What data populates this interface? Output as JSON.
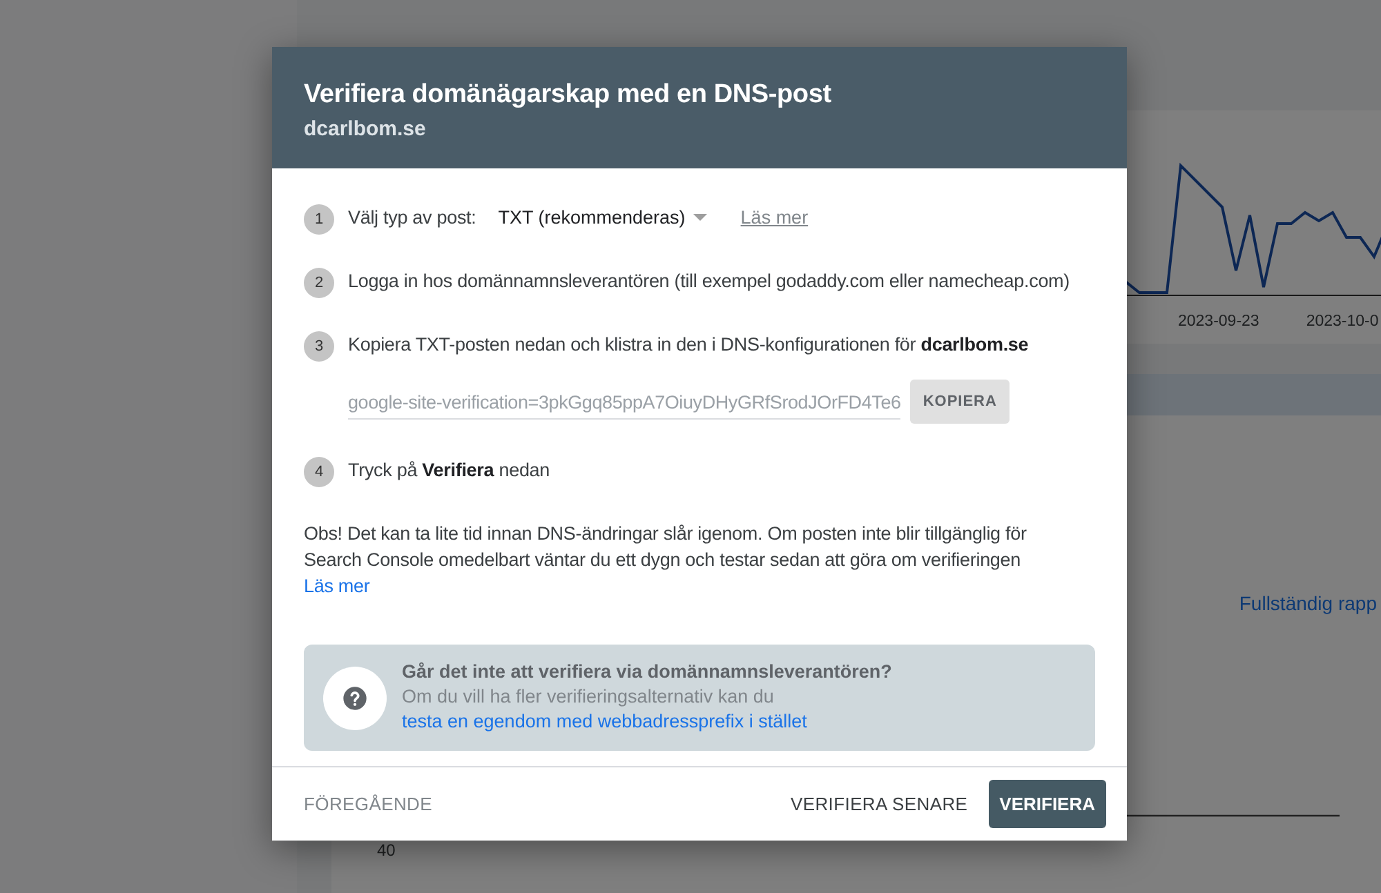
{
  "background": {
    "date_labels": [
      "2023-09-23",
      "2023-10-0"
    ],
    "report_link": "Fullständig rapp",
    "axis_label": "40"
  },
  "dialog": {
    "title": "Verifiera domänägarskap med en DNS-post",
    "subtitle": "dcarlbom.se",
    "steps": [
      {
        "number": "1",
        "kind": "select",
        "label": "Välj typ av post:",
        "value": "TXT (rekommenderas)",
        "link": "Läs mer"
      },
      {
        "number": "2",
        "kind": "text",
        "text": "Logga in hos domännamnsleverantören (till exempel godaddy.com eller namecheap.com)"
      },
      {
        "number": "3",
        "kind": "copy",
        "text": "Kopiera TXT-posten nedan och klistra in den i DNS-konfigurationen för **dcarlbom.se**",
        "record": "google-site-verification=3pkGgq85ppA7OiuyDHyGRfSrodJOrFD4Te6",
        "button": "KOPIERA"
      },
      {
        "number": "4",
        "kind": "text",
        "text": "Tryck på **Verifiera** nedan"
      }
    ],
    "note": "Obs! Det kan ta lite tid innan DNS-ändringar slår igenom. Om posten inte blir tillgänglig för Search Console omedelbart väntar du ett dygn och testar sedan att göra om verifieringen",
    "note_link": "Läs mer",
    "help": {
      "title": "Går det inte att verifiera via domännamnsleverantören?",
      "text": "Om du vill ha fler verifieringsalternativ kan du",
      "link": "testa en egendom med webbadressprefix i stället"
    },
    "footer": {
      "back": "FÖREGÅENDE",
      "later": "VERIFIERA SENARE",
      "verify": "VERIFIERA"
    }
  }
}
